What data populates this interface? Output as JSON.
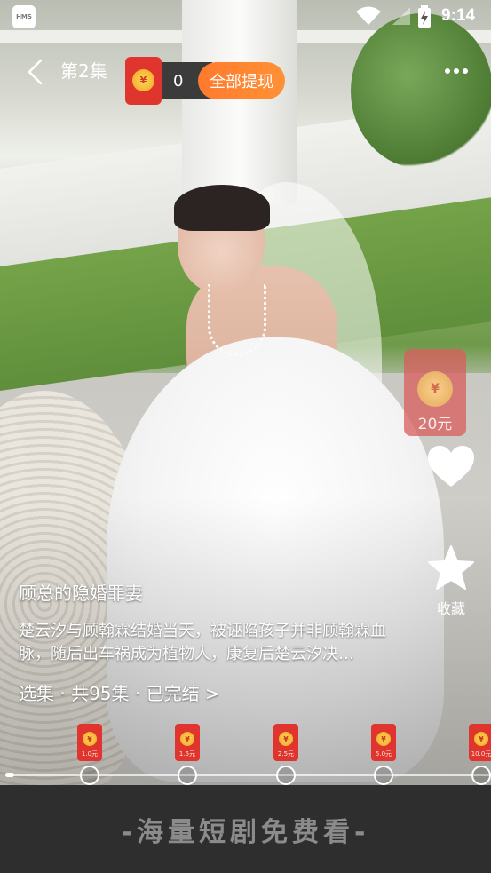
{
  "status_bar": {
    "app_badge": "HMS",
    "time": "9:14"
  },
  "header": {
    "episode_title": "第2集",
    "reward_count": "0",
    "withdraw_all_label": "全部提现",
    "coin_symbol": "¥"
  },
  "side_actions": {
    "coupon_amount": "20元",
    "favorite_label": "收藏"
  },
  "drama": {
    "title": "顾总的隐婚罪妻",
    "description": "楚云汐与顾翰霖结婚当天，被诬陷孩子并非顾翰霖血脉，随后出车祸成为植物人，康复后楚云汐决…",
    "episodes_link": "选集 · 共95集 · 已完结 >"
  },
  "milestones": [
    {
      "amount": "1.0元"
    },
    {
      "amount": "1.5元"
    },
    {
      "amount": "2.5元"
    },
    {
      "amount": "5.0元"
    },
    {
      "amount": "10.0元"
    }
  ],
  "progress_fraction": 0.015,
  "banner": {
    "text": "-海量短剧免费看-"
  },
  "colors": {
    "red_packet": "#e0342f",
    "withdraw_orange": "#ff8330",
    "banner_bg": "#2e2e2e",
    "banner_text": "#8b8b8b"
  }
}
